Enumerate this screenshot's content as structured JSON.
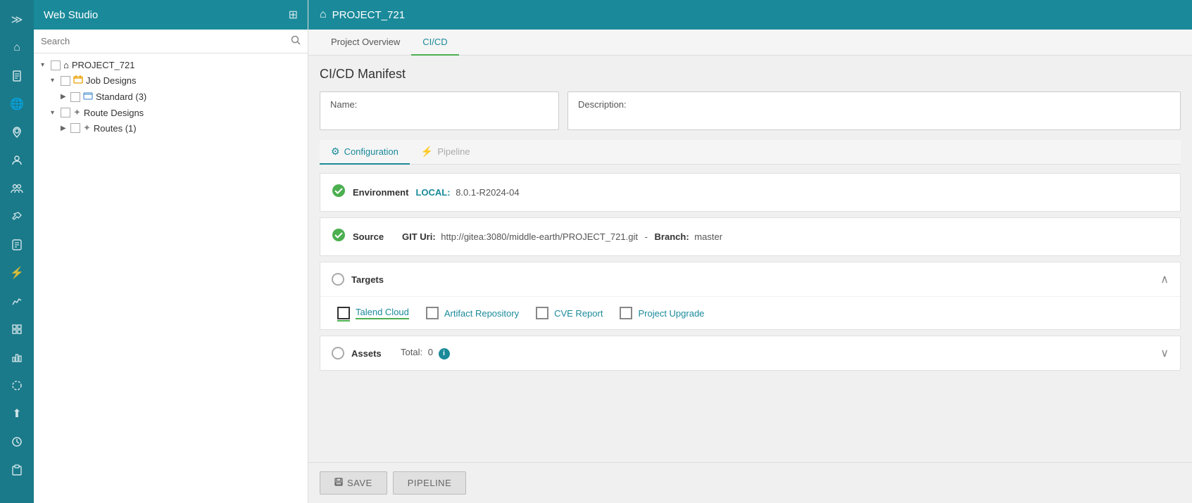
{
  "iconSidebar": {
    "icons": [
      {
        "name": "expand-icon",
        "symbol": "≫",
        "interactable": true
      },
      {
        "name": "home-icon",
        "symbol": "⌂",
        "interactable": true
      },
      {
        "name": "document-icon",
        "symbol": "📄",
        "interactable": true
      },
      {
        "name": "globe-icon",
        "symbol": "🌐",
        "interactable": true
      },
      {
        "name": "location-icon",
        "symbol": "📍",
        "interactable": true
      },
      {
        "name": "person-icon",
        "symbol": "👤",
        "interactable": true
      },
      {
        "name": "group-icon",
        "symbol": "👥",
        "interactable": true
      },
      {
        "name": "tools-icon",
        "symbol": "🔧",
        "interactable": true
      },
      {
        "name": "badge-icon",
        "symbol": "🔖",
        "interactable": true
      },
      {
        "name": "bolt-icon",
        "symbol": "⚡",
        "interactable": true
      },
      {
        "name": "chart-icon",
        "symbol": "📊",
        "interactable": true
      },
      {
        "name": "grid-icon",
        "symbol": "⊞",
        "interactable": true
      },
      {
        "name": "bar-chart-icon",
        "symbol": "📈",
        "interactable": true
      },
      {
        "name": "circle-icon",
        "symbol": "◎",
        "interactable": true
      },
      {
        "name": "upload-icon",
        "symbol": "⬆",
        "interactable": true
      },
      {
        "name": "clock-icon",
        "symbol": "🕐",
        "interactable": true
      },
      {
        "name": "clipboard-icon",
        "symbol": "📋",
        "interactable": true
      }
    ]
  },
  "webStudio": {
    "title": "Web Studio",
    "searchPlaceholder": "Search"
  },
  "tree": {
    "items": [
      {
        "id": "project",
        "label": "PROJECT_721",
        "indent": 1,
        "arrow": "▾",
        "icon": "⌂",
        "hasCheckbox": true
      },
      {
        "id": "job-designs",
        "label": "Job Designs",
        "indent": 2,
        "arrow": "▾",
        "icon": "📁",
        "hasCheckbox": true
      },
      {
        "id": "standard",
        "label": "Standard (3)",
        "indent": 3,
        "arrow": "▶",
        "icon": "📂",
        "hasCheckbox": true
      },
      {
        "id": "route-designs",
        "label": "Route Designs",
        "indent": 2,
        "arrow": "▾",
        "icon": "✦",
        "hasCheckbox": true
      },
      {
        "id": "routes",
        "label": "Routes (1)",
        "indent": 3,
        "arrow": "▶",
        "icon": "✦",
        "hasCheckbox": true
      }
    ]
  },
  "mainHeader": {
    "projectName": "PROJECT_721"
  },
  "tabs": {
    "items": [
      {
        "id": "project-overview",
        "label": "Project Overview",
        "active": false
      },
      {
        "id": "cicd",
        "label": "CI/CD",
        "active": true
      }
    ]
  },
  "cicd": {
    "title": "CI/CD Manifest",
    "nameLabel": "Name:",
    "descriptionLabel": "Description:",
    "subTabs": [
      {
        "id": "configuration",
        "label": "Configuration",
        "icon": "⚙",
        "active": true
      },
      {
        "id": "pipeline",
        "label": "Pipeline",
        "icon": "⚡",
        "active": false
      }
    ],
    "environment": {
      "label": "Environment",
      "key": "LOCAL:",
      "value": "8.0.1-R2024-04",
      "status": "ok"
    },
    "source": {
      "label": "Source",
      "gitUri": "GIT Uri:",
      "gitValue": "http://gitea:3080/middle-earth/PROJECT_721.git",
      "branchLabel": "Branch:",
      "branchValue": "master",
      "status": "ok"
    },
    "targets": {
      "label": "Targets",
      "options": [
        {
          "id": "talend-cloud",
          "label": "Talend Cloud",
          "active": true
        },
        {
          "id": "artifact-repository",
          "label": "Artifact Repository",
          "active": false
        },
        {
          "id": "cve-report",
          "label": "CVE Report",
          "active": false
        },
        {
          "id": "project-upgrade",
          "label": "Project Upgrade",
          "active": false
        }
      ]
    },
    "assets": {
      "label": "Assets",
      "totalLabel": "Total:",
      "totalValue": "0"
    },
    "buttons": {
      "save": "SAVE",
      "pipeline": "PIPELINE"
    }
  }
}
